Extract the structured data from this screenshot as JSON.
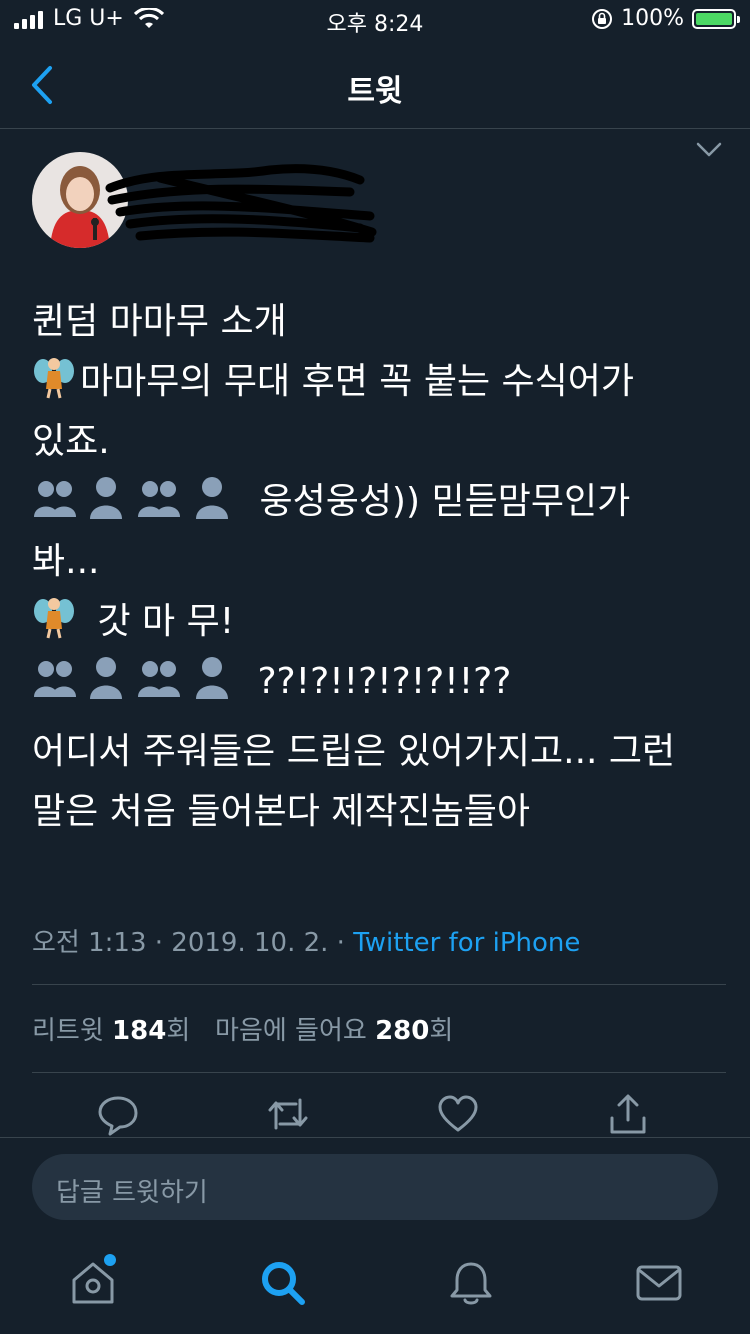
{
  "status_bar": {
    "carrier": "LG U+",
    "time": "오후 8:24",
    "battery_percent": "100%",
    "battery_level": 1.0,
    "signal_bars": 4
  },
  "nav": {
    "title": "트윗"
  },
  "tweet": {
    "text_lines": [
      "퀸덤 마마무 소개",
      "마마무의 무대 후면 꼭 붙는 수식어가",
      "있죠.",
      "웅성웅성)) 믿듣맘무인가",
      "봐...",
      "갓 마 무!",
      "??!?!!?!?!?!!??"
    ],
    "body_lines": [
      "어디서 주워들은 드립은 있어가지고... 그런",
      "말은 처음 들어본다 제작진놈들아"
    ],
    "timestamp": "오전 1:13 · 2019. 10. 2. · ",
    "source": "Twitter for iPhone"
  },
  "stats": {
    "retweet_label": "리트윗",
    "retweet_count": "184",
    "retweet_unit": "회",
    "like_label": "마음에 들어요",
    "like_count": "280",
    "like_unit": "회"
  },
  "reply": {
    "placeholder": "답글 트윗하기"
  },
  "icons": {
    "back": "chevron-left-icon",
    "more": "chevron-down-icon",
    "reply": "reply-icon",
    "retweet": "retweet-icon",
    "like": "heart-icon",
    "share": "share-icon",
    "home": "home-icon",
    "search": "search-icon",
    "notifications": "bell-icon",
    "messages": "mail-icon"
  },
  "colors": {
    "background": "#15202b",
    "accent": "#1da1f2",
    "muted": "#8899a6",
    "divider": "#38444d"
  }
}
